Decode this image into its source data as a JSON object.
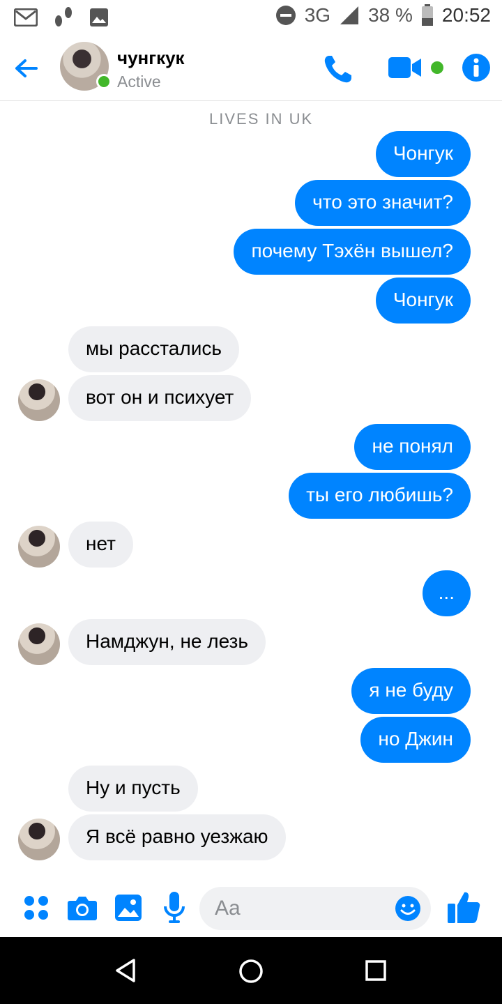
{
  "status_bar": {
    "network": "3G",
    "network_small": "3G",
    "battery": "38 %",
    "time": "20:52"
  },
  "header": {
    "contact_name": "чунгкук",
    "contact_status": "Active"
  },
  "chat": {
    "cut_off_text": "LIVES IN UK",
    "messages": [
      {
        "dir": "out",
        "text": "Чонгук"
      },
      {
        "dir": "out",
        "text": "что это значит?"
      },
      {
        "dir": "out",
        "text": "почему Тэхён вышел?"
      },
      {
        "dir": "out",
        "text": "Чонгук"
      },
      {
        "dir": "in",
        "text": "мы расстались"
      },
      {
        "dir": "in",
        "text": "вот он и психует"
      },
      {
        "dir": "out",
        "text": "не понял"
      },
      {
        "dir": "out",
        "text": "ты его любишь?"
      },
      {
        "dir": "in",
        "text": "нет"
      },
      {
        "dir": "out",
        "text": "..."
      },
      {
        "dir": "in",
        "text": "Намджун, не лезь"
      },
      {
        "dir": "out",
        "text": "я не буду"
      },
      {
        "dir": "out",
        "text": "но Джин"
      },
      {
        "dir": "in",
        "text": "Ну и пусть"
      },
      {
        "dir": "in",
        "text": "Я всё равно уезжаю"
      }
    ]
  },
  "composer": {
    "placeholder": "Aa"
  },
  "colors": {
    "accent": "#0084ff",
    "incoming_bubble": "#eeeff2",
    "online": "#42b72a"
  },
  "icons": [
    "gmail-icon",
    "footsteps-icon",
    "image-icon",
    "dnd-icon",
    "signal-icon",
    "battery-icon",
    "back-arrow-icon",
    "phone-icon",
    "video-icon",
    "info-icon",
    "apps-icon",
    "camera-icon",
    "gallery-icon",
    "mic-icon",
    "emoji-icon",
    "thumbs-up-icon",
    "nav-back-icon",
    "nav-home-icon",
    "nav-recents-icon"
  ]
}
